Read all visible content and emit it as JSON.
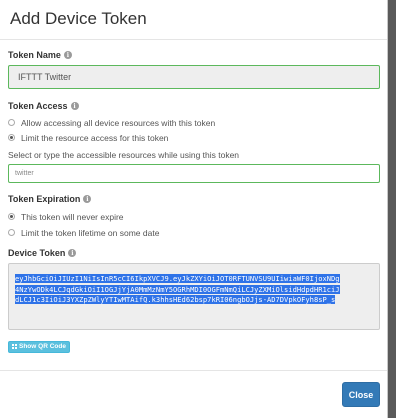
{
  "modal": {
    "title": "Add Device Token",
    "token_name": {
      "label": "Token Name",
      "value": "IFTTT Twitter"
    },
    "token_access": {
      "label": "Token Access",
      "options": [
        {
          "label": "Allow accessing all device resources with this token",
          "checked": false
        },
        {
          "label": "Limit the resource access for this token",
          "checked": true
        }
      ],
      "resources_helper": "Select or type the accessible resources while using this token",
      "resources_value": "twitter"
    },
    "token_expiration": {
      "label": "Token Expiration",
      "options": [
        {
          "label": "This token will never expire",
          "checked": true
        },
        {
          "label": "Limit the token lifetime on some date",
          "checked": false
        }
      ]
    },
    "device_token": {
      "label": "Device Token",
      "lines": [
        "eyJhbGciOiJIUzI1NiIsInR5cCI6IkpXVCJ9.eyJkZXYiOiJOT0RFTUNVSU9UIiwiaWF0IjoxNDg",
        "4NzYwODk4LCJqdGkiOiI1OGJjYjA0MmMzNmY5OGRhMDI0OGFmNmQiLCJyZXMiOlsidHdpdHR1ciJ",
        "dLCJ1c3IiOiJ3YXZpZWlyYTIwMTAifQ.k3hhsHEd62bsp7kRI06ngbOJjs-AD7DVpkOFyh8sP_s"
      ],
      "qr_button": "Show QR Code"
    },
    "close_button": "Close"
  },
  "colors": {
    "success_border": "#5cb85c",
    "primary": "#337ab7",
    "info": "#5bc0de",
    "selection": "#2f73e8"
  },
  "icons": {
    "info": "info-circle-icon",
    "qr": "qrcode-icon"
  }
}
